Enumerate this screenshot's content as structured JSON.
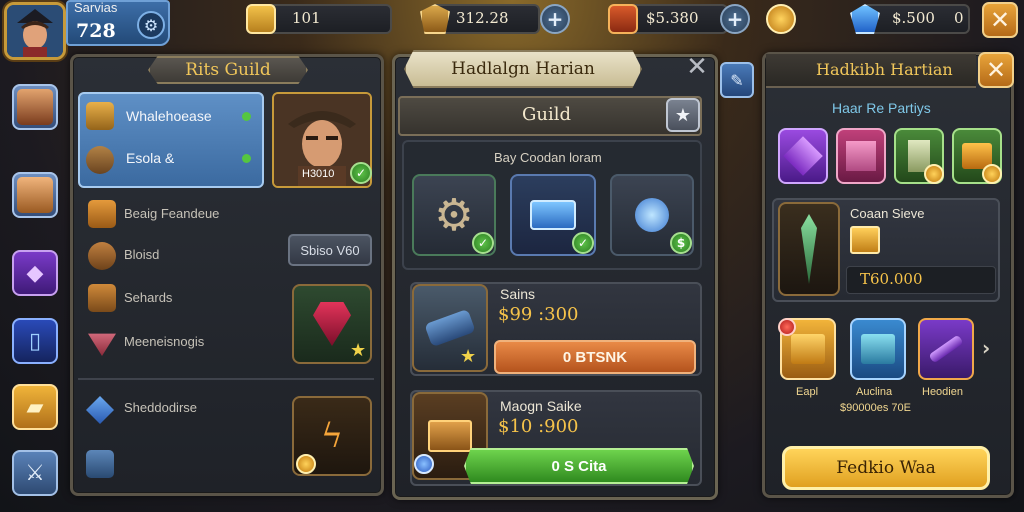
{
  "player": {
    "name": "Sarvias",
    "level": "728"
  },
  "resources": [
    {
      "icon": "gold-bar-icon",
      "value": "101"
    },
    {
      "icon": "shield-crest-icon",
      "value": "312.28"
    },
    {
      "icon": "chest-icon",
      "value": "$5.380"
    },
    {
      "icon": "coin-icon",
      "value": ""
    },
    {
      "icon": "gem-icon",
      "value": "$.500",
      "suffix": "0"
    }
  ],
  "guild_panel": {
    "title": "Rits Guild",
    "selected_items": [
      {
        "label": "Whalehoease"
      },
      {
        "label": "Esola &"
      }
    ],
    "portrait_badge": "H3010",
    "items": [
      {
        "label": "Beaig Feandeue"
      },
      {
        "label": "Bloisd"
      },
      {
        "label": "Sehards"
      },
      {
        "label": "Meeneisnogis"
      },
      {
        "label": "Sheddodirse"
      }
    ],
    "tag": "Sbiso V60"
  },
  "center_panel": {
    "banner": "Hadlalgn Harian",
    "subtitle": "Guild",
    "section_label": "Bay Coodan loram",
    "shop_items": [
      {
        "name": "Sains",
        "price": "$99 :300",
        "button": "0 BTSNK"
      },
      {
        "name": "Maogn Saike",
        "price": "$10 :900",
        "button": "0 S Cita"
      }
    ]
  },
  "right_panel": {
    "title": "Hadkibh Hartian",
    "subtitle": "Haar Re Partiys",
    "featured": {
      "name": "Coaan Sieve",
      "price": "T60.000"
    },
    "rewards": [
      {
        "label": "Eapl"
      },
      {
        "label": "Auclina"
      },
      {
        "label": "Heodien"
      }
    ],
    "reward_price": "$90000es 70E",
    "cta": "Fedkio Waa"
  },
  "colors": {
    "gold": "#f0c65a",
    "accent_orange": "#e98a47",
    "accent_green": "#55c640",
    "panel_bg": "#23272e"
  }
}
